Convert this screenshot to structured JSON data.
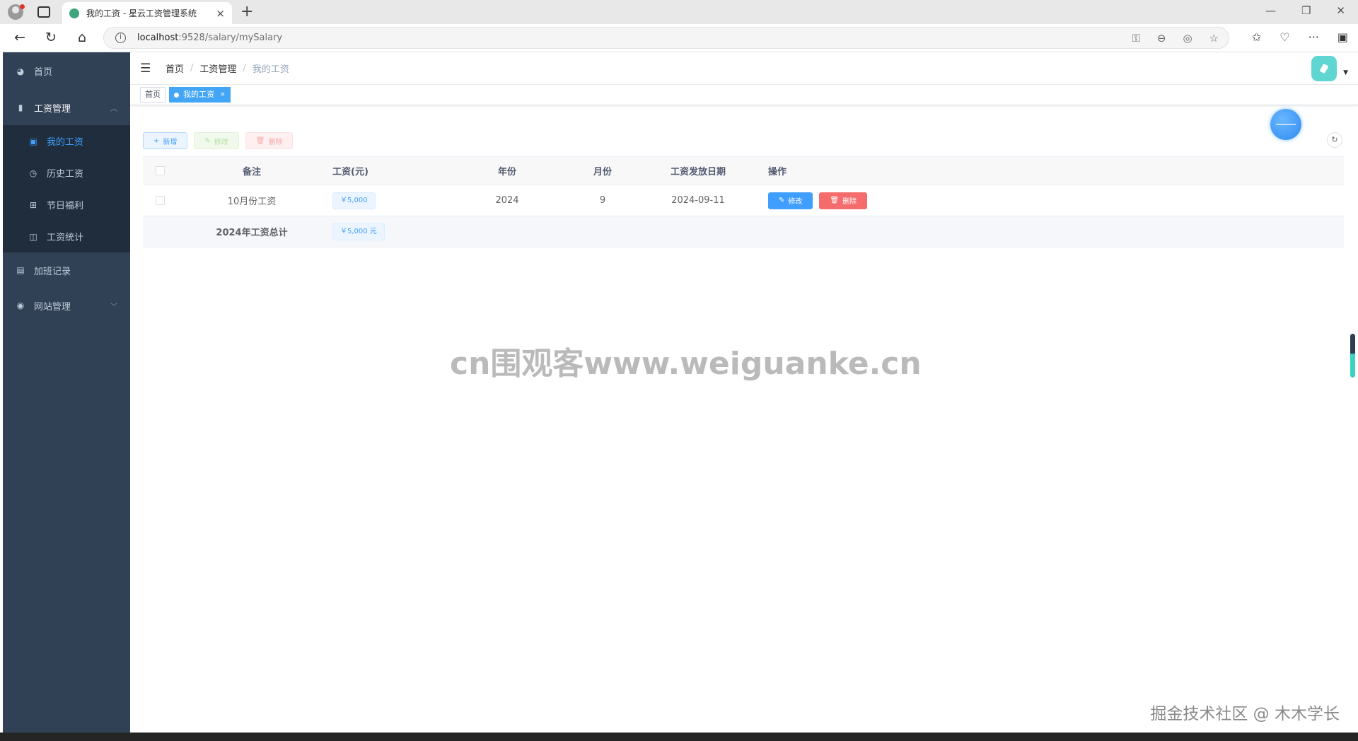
{
  "browser": {
    "tab_title": "我的工资 - 星云工资管理系统",
    "tab_close": "×",
    "new_tab": "+",
    "url_host": "localhost",
    "url_path": ":9528/salary/mySalary",
    "win_minimize": "—",
    "win_restore": "❐",
    "win_close": "✕"
  },
  "sidebar": {
    "home": "首页",
    "salary_management": "工资管理",
    "sub_items": [
      {
        "label": "我的工资"
      },
      {
        "label": "历史工资"
      },
      {
        "label": "节日福利"
      },
      {
        "label": "工资统计"
      }
    ],
    "overtime": "加班记录",
    "site_management": "网站管理"
  },
  "navbar": {
    "breadcrumb": [
      "首页",
      "工资管理",
      "我的工资"
    ]
  },
  "tags": {
    "home": "首页",
    "active": "我的工资",
    "close": "×"
  },
  "toolbar": {
    "add": "新增",
    "edit": "修改",
    "delete": "删除"
  },
  "table": {
    "headers": {
      "note": "备注",
      "salary": "工资(元)",
      "year": "年份",
      "month": "月份",
      "pay_date": "工资发放日期",
      "ops": "操作"
    },
    "rows": [
      {
        "note": "10月份工资",
        "salary": "￥5,000",
        "year": "2024",
        "month": "9",
        "pay_date": "2024-09-11",
        "edit": "修改",
        "delete": "删除"
      }
    ],
    "summary": {
      "label": "2024年工资总计",
      "value": "￥5,000 元"
    }
  },
  "overlays": {
    "watermark": "cn围观客www.weiguanke.cn",
    "credit": "掘金技术社区 @ 木木学长"
  },
  "colors": {
    "sidebar_bg": "#304156",
    "primary": "#409eff",
    "danger": "#f56c6c"
  }
}
